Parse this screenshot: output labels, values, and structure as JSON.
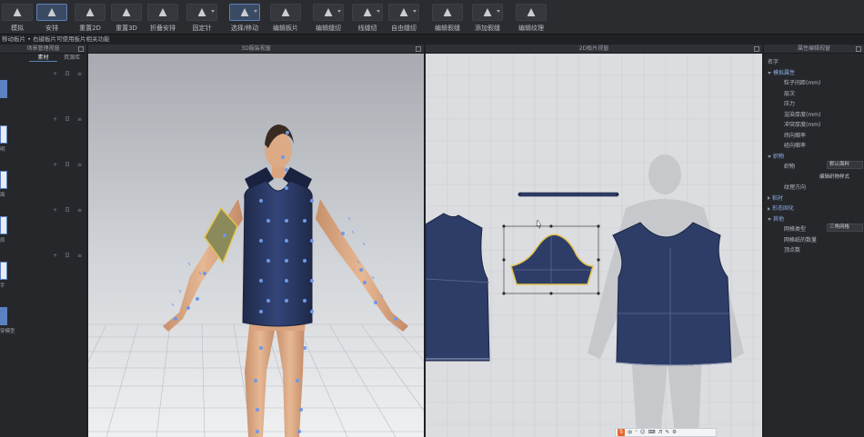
{
  "toolbar": {
    "buttons": [
      {
        "label": "模拟",
        "icon": "simulate-icon",
        "caret": false
      },
      {
        "label": "安排",
        "icon": "arrange-icon",
        "caret": false,
        "active": true
      },
      {
        "label": "重置2D",
        "icon": "reset-2d-icon",
        "caret": false
      },
      {
        "label": "重置3D",
        "icon": "reset-3d-icon",
        "caret": false
      },
      {
        "label": "折叠安排",
        "icon": "fold-arrange-icon",
        "caret": false
      },
      {
        "label": "固定针",
        "icon": "pin-icon",
        "caret": true
      },
      {
        "label": "选择/移动",
        "icon": "select-move-icon",
        "caret": true,
        "active": true
      },
      {
        "label": "编辑板片",
        "icon": "edit-pattern-icon",
        "caret": false
      },
      {
        "label": "编辑缝纫",
        "icon": "edit-sewing-icon",
        "caret": true
      },
      {
        "label": "线缝纫",
        "icon": "segment-sewing-icon",
        "caret": true
      },
      {
        "label": "自由缝纫",
        "icon": "free-sewing-icon",
        "caret": true
      },
      {
        "label": "编辑假缝",
        "icon": "edit-tack-icon",
        "caret": false
      },
      {
        "label": "添加假缝",
        "icon": "add-tack-icon",
        "caret": true
      },
      {
        "label": "编辑纹理",
        "icon": "edit-texture-icon",
        "caret": false
      }
    ]
  },
  "breadcrumb": "移动板片 • 右键板片可使用板片相关功能",
  "left_panel": {
    "title": "场景管理视窗",
    "tabs": [
      "",
      "素材",
      "資源库"
    ],
    "sections": [
      {
        "label": "",
        "thumb_label": ""
      },
      {
        "label": "",
        "thumb_label": "明"
      },
      {
        "label": "",
        "thumb_label": "面"
      },
      {
        "label": "",
        "thumb_label": "原"
      },
      {
        "label": "",
        "thumb_label": "手"
      },
      {
        "label": "",
        "thumb_label": "穿模型"
      }
    ],
    "ops": "+ 日 ≡"
  },
  "view3d": {
    "title": "3D服装视窗"
  },
  "view2d": {
    "title": "2D板片视窗"
  },
  "right_panel": {
    "title": "属性编辑视窗",
    "rows": [
      {
        "indent": 0,
        "key": "名字",
        "type": "plain"
      },
      {
        "indent": 0,
        "key": "模拟属性",
        "type": "section-open",
        "accent": true
      },
      {
        "indent": 1,
        "key": "粒子间距(mm)",
        "type": "plain"
      },
      {
        "indent": 1,
        "key": "层次",
        "type": "plain"
      },
      {
        "indent": 1,
        "key": "压力",
        "type": "plain"
      },
      {
        "indent": 1,
        "key": "渲染厚度(mm)",
        "type": "plain"
      },
      {
        "indent": 1,
        "key": "冲突厚度(mm)",
        "type": "plain"
      },
      {
        "indent": 1,
        "key": "纬向缩率",
        "type": "plain"
      },
      {
        "indent": 1,
        "key": "经向缩率",
        "type": "plain"
      },
      {
        "indent": 0,
        "key": "织物",
        "type": "section-open",
        "accent": true
      },
      {
        "indent": 1,
        "key": "织物",
        "type": "value",
        "value": "默认面料"
      },
      {
        "indent": 1,
        "key": "",
        "type": "link",
        "value": "编辑织物样式"
      },
      {
        "indent": 1,
        "key": "纹理方向",
        "type": "plain"
      },
      {
        "indent": 0,
        "key": "粘衬",
        "type": "section-closed",
        "accent": true
      },
      {
        "indent": 0,
        "key": "形态固化",
        "type": "section-closed",
        "accent": true
      },
      {
        "indent": 0,
        "key": "其他",
        "type": "section-open",
        "accent": true
      },
      {
        "indent": 1,
        "key": "网格类型",
        "type": "value",
        "value": "三角网格"
      },
      {
        "indent": 1,
        "key": "网格纸的数量",
        "type": "plain"
      },
      {
        "indent": 1,
        "key": "顶点数",
        "type": "plain"
      }
    ]
  },
  "ime_bar": {
    "logo": "S",
    "items": [
      "中",
      "ᵒ",
      "☺",
      "⌨",
      "♬",
      "✎",
      "⚙"
    ]
  },
  "colors": {
    "fabric": "#2e3d67",
    "fabric_dark": "#222e50",
    "point": "#6f98e8",
    "selection_yellow": "#e3c34b",
    "sleeve_selected": "#8a8a5a"
  }
}
